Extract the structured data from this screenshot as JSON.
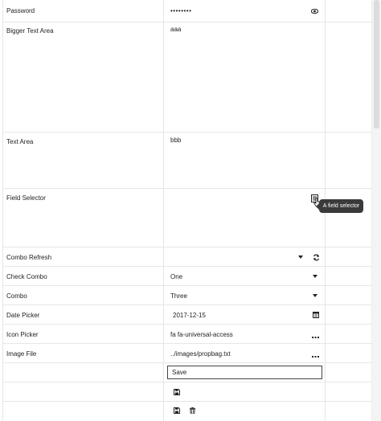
{
  "properties": {
    "password": {
      "label": "Password",
      "value": "••••••••"
    },
    "bigger_text_area": {
      "label": "Bigger Text Area",
      "value": "aaa"
    },
    "text_area": {
      "label": "Text Area",
      "value": "bbb"
    },
    "field_selector": {
      "label": "Field Selector",
      "tooltip": "A field selector"
    },
    "combo_refresh": {
      "label": "Combo Refresh",
      "value": ""
    },
    "check_combo": {
      "label": "Check Combo",
      "value": "One"
    },
    "combo": {
      "label": "Combo",
      "value": "Three"
    },
    "date_picker": {
      "label": "Date Picker",
      "value": "2017-12-15"
    },
    "icon_picker": {
      "label": "Icon Picker",
      "value": "fa fa-universal-access"
    },
    "image_file": {
      "label": "Image File",
      "value": "../images/propbag.txt"
    },
    "save_row": {
      "value": "Save"
    }
  },
  "icons": {
    "password_toggle": "eye-icon",
    "field_selector": "field-selector-icon",
    "combo_refresh": "refresh-icon",
    "date_picker": "calendar-icon",
    "icon_picker": "ellipsis-icon",
    "image_file": "ellipsis-icon",
    "save": "floppy-disk-icon",
    "delete": "trash-icon",
    "cursor": "hand-pointer-icon"
  }
}
